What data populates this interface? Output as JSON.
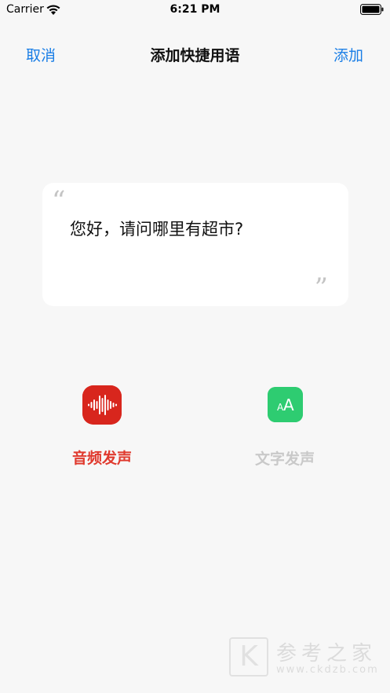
{
  "status_bar": {
    "carrier": "Carrier",
    "time": "6:21 PM"
  },
  "nav": {
    "cancel_label": "取消",
    "title": "添加快捷用语",
    "add_label": "添加"
  },
  "phrase": {
    "open_quote": "“",
    "text": "您好，请问哪里有超市?",
    "close_quote": "”"
  },
  "options": {
    "audio": {
      "label": "音频发声",
      "color": "#d8261d",
      "icon": "waveform-icon"
    },
    "text": {
      "label": "文字发声",
      "color": "#2ecc71",
      "icon": "text-size-icon",
      "icon_glyph": "AA"
    }
  },
  "watermark": {
    "logo": "K",
    "text": "参考之家",
    "url": "www.ckdzb.com"
  },
  "colors": {
    "accent": "#1a7ee6",
    "background": "#f7f7f7"
  }
}
